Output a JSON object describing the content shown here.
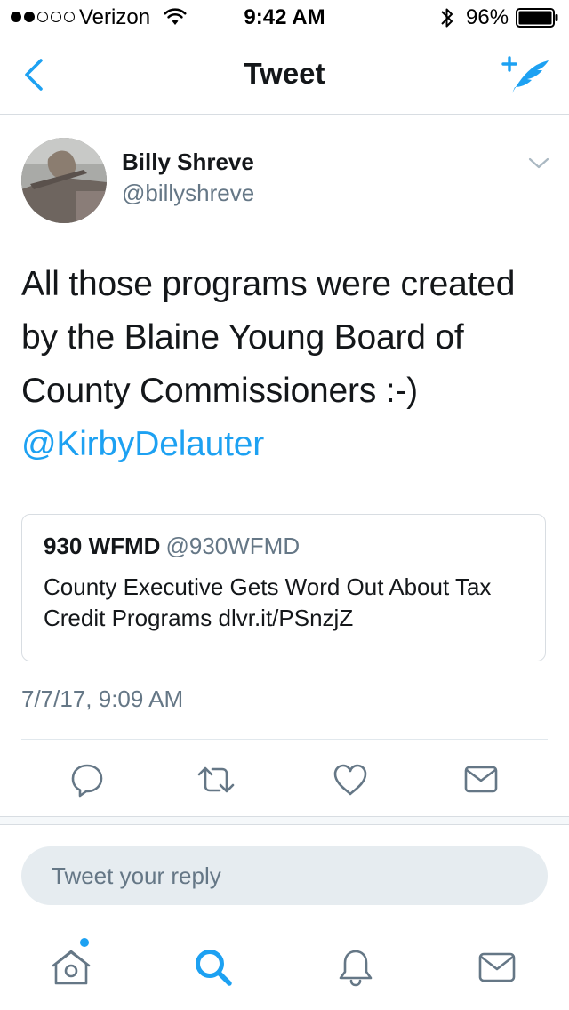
{
  "status_bar": {
    "carrier": "Verizon",
    "time": "9:42 AM",
    "battery_percent": "96%",
    "signal_bars_filled": 2,
    "signal_bars_total": 5
  },
  "nav": {
    "title": "Tweet",
    "back_icon": "chevron-left-icon",
    "compose_icon": "compose-feather-icon"
  },
  "tweet": {
    "author_name": "Billy Shreve",
    "author_handle": "@billyshreve",
    "text": "All those programs were created by the Blaine Young Board of County Commissioners :-)",
    "mention": "@KirbyDelauter",
    "timestamp": "7/7/17, 9:09 AM",
    "quote": {
      "name": "930 WFMD",
      "handle": "@930WFMD",
      "text": "County Executive Gets Word Out About Tax Credit Programs dlvr.it/PSnzjZ"
    }
  },
  "actions": [
    {
      "name": "reply-icon"
    },
    {
      "name": "retweet-icon"
    },
    {
      "name": "like-heart-icon"
    },
    {
      "name": "direct-message-icon"
    }
  ],
  "reply": {
    "placeholder": "Tweet your reply"
  },
  "tab_bar": {
    "items": [
      "home-icon",
      "search-icon",
      "notifications-bell-icon",
      "messages-icon"
    ],
    "home_has_new": true
  },
  "colors": {
    "accent": "#1da1f2",
    "secondary_text": "#657786",
    "primary_text": "#14171a",
    "border": "#d8dde2"
  }
}
